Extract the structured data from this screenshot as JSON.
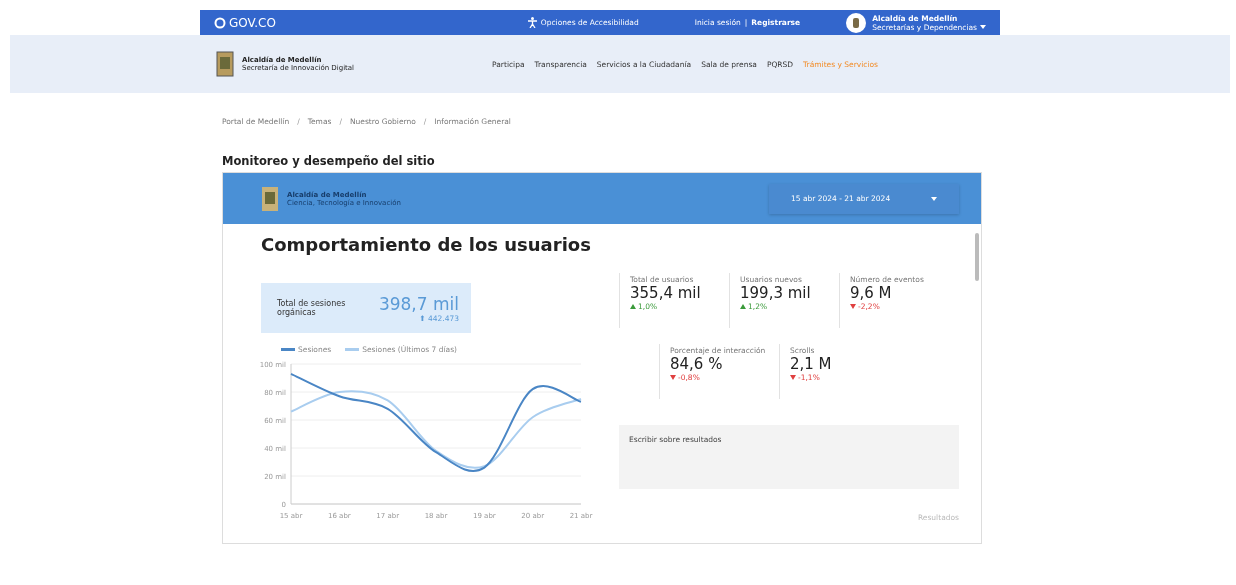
{
  "top_bar": {
    "brand": "GOV.CO",
    "accessibility": "Opciones de Accesibilidad",
    "login": "Inicia sesión",
    "separator": "|",
    "register": "Registrarse",
    "entity": "Alcaldía de Medellín",
    "entity_sub": "Secretarías y Dependencias"
  },
  "nav": {
    "logo_title": "Alcaldía de Medellín",
    "logo_sub": "Secretaría de Innovación Digital",
    "items": [
      {
        "label": "Participa",
        "selected": false
      },
      {
        "label": "Transparencia",
        "selected": false
      },
      {
        "label": "Servicios a la Ciudadanía",
        "selected": false
      },
      {
        "label": "Sala de prensa",
        "selected": false
      },
      {
        "label": "PQRSD",
        "selected": false
      },
      {
        "label": "Trámites y Servicios",
        "selected": true
      }
    ]
  },
  "breadcrumb": {
    "separator": "/",
    "items": [
      "Portal de Medellín",
      "Temas",
      "Nuestro Gobierno",
      "Información General"
    ]
  },
  "page_title": "Monitoreo y desempeño del sitio",
  "dashboard": {
    "logo_title": "Alcaldía de Medellín",
    "logo_sub": "Ciencia, Tecnología e Innovación",
    "date_range": "15 abr 2024 - 21 abr 2024",
    "heading": "Comportamiento de los usuarios",
    "highlight": {
      "label": "Total de sesiones orgánicas",
      "value": "398,7 mil",
      "change": "⬆ 442.473"
    },
    "metrics": [
      {
        "label": "Total de usuarios",
        "value": "355,4 mil",
        "change": "1,0%",
        "rising": true
      },
      {
        "label": "Usuarios nuevos",
        "value": "199,3 mil",
        "change": "1,2%",
        "rising": true
      },
      {
        "label": "Número de eventos",
        "value": "9,6 M",
        "change": "-2,2%",
        "rising": false
      },
      {
        "label": "Porcentaje de interacción",
        "value": "84,6 %",
        "change": "-0,8%",
        "rising": false
      },
      {
        "label": "Scrolls",
        "value": "2,1 M",
        "change": "-1,1%",
        "rising": false
      }
    ],
    "comment_placeholder": "Escribir sobre resultados",
    "footer_note": "Resultados",
    "chart_data": {
      "type": "line",
      "grid": true,
      "categories": [
        "15 abr",
        "16 abr",
        "17 abr",
        "18 abr",
        "19 abr",
        "20 abr",
        "21 abr"
      ],
      "ylim": [
        0,
        100
      ],
      "yticks": [
        0,
        {
          "value": 20,
          "label": "20 mil"
        },
        {
          "value": 40,
          "label": "40 mil"
        },
        {
          "value": 60,
          "label": "60 mil"
        },
        {
          "value": 80,
          "label": "80 mil"
        },
        {
          "value": 100,
          "label": "100 mil"
        }
      ],
      "series": [
        {
          "name": "Sesiones",
          "color": "#4a86c5",
          "values": [
            93,
            77,
            68,
            37,
            26,
            82,
            73
          ]
        },
        {
          "name": "Sesiones (Últimos 7 días)",
          "color": "#a9cdef",
          "values": [
            66,
            80,
            74,
            38,
            27,
            62,
            75
          ]
        }
      ]
    }
  }
}
